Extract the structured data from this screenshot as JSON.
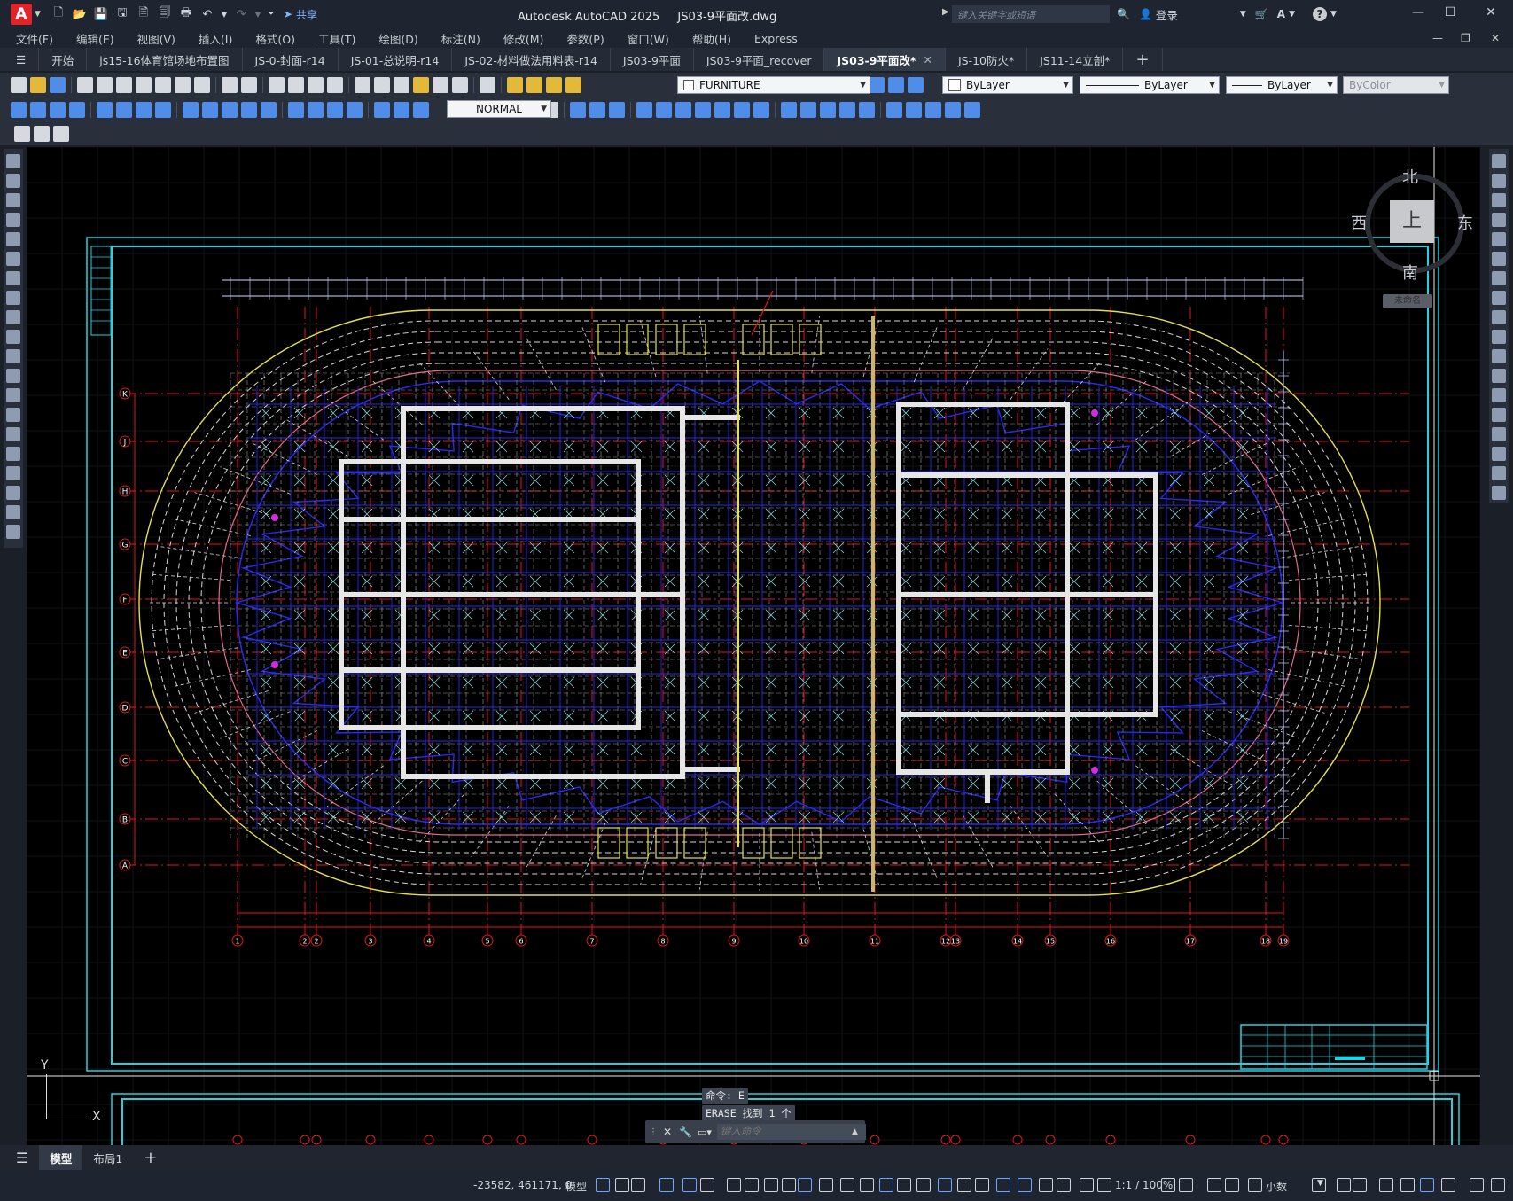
{
  "app": {
    "logo_letter": "A",
    "title": "Autodesk AutoCAD 2025",
    "file": "JS03-9平面改.dwg",
    "share_label": "共享",
    "search_placeholder": "键入关键字或短语",
    "login_label": "登录"
  },
  "menu": [
    "文件(F)",
    "编辑(E)",
    "视图(V)",
    "插入(I)",
    "格式(O)",
    "工具(T)",
    "绘图(D)",
    "标注(N)",
    "修改(M)",
    "参数(P)",
    "窗口(W)",
    "帮助(H)",
    "Express"
  ],
  "doc_tabs": [
    {
      "label": "开始",
      "active": false
    },
    {
      "label": "js15-16体育馆场地布置图",
      "active": false
    },
    {
      "label": "JS-0-封面-r14",
      "active": false
    },
    {
      "label": "JS-01-总说明-r14",
      "active": false
    },
    {
      "label": "JS-02-材料做法用料表-r14",
      "active": false
    },
    {
      "label": "JS03-9平面",
      "active": false
    },
    {
      "label": "JS03-9平面_recover",
      "active": false
    },
    {
      "label": "JS03-9平面改*",
      "active": true
    },
    {
      "label": "JS-10防火*",
      "active": false
    },
    {
      "label": "JS11-14立剖*",
      "active": false
    }
  ],
  "new_tab_label": "+",
  "properties": {
    "layer": "FURNITURE",
    "color": "ByLayer",
    "linetype": "ByLayer",
    "lineweight": "ByLayer",
    "plotstyle": "ByColor",
    "textstyle": "NORMAL"
  },
  "viewcube": {
    "north": "北",
    "south": "南",
    "east": "东",
    "west": "西",
    "top": "上",
    "ucs": "未命名"
  },
  "ucs_axis": {
    "y": "Y",
    "x": "X"
  },
  "grid_rows": [
    "K",
    "J",
    "H",
    "G",
    "F",
    "E",
    "D",
    "C",
    "B",
    "A"
  ],
  "grid_cols": [
    "1",
    "2",
    "2",
    "3",
    "4",
    "5",
    "6",
    "7",
    "8",
    "9",
    "10",
    "11",
    "12",
    "13",
    "14",
    "15",
    "16",
    "17",
    "18",
    "19"
  ],
  "command": {
    "history": [
      "命令: E",
      "ERASE 找到 1 个"
    ],
    "placeholder": "键入命令"
  },
  "layout_tabs": [
    {
      "label": "模型",
      "active": true
    },
    {
      "label": "布局1",
      "active": false
    }
  ],
  "status": {
    "coords": "-23582, 461171, 0",
    "space": "模型",
    "scale": "1:1 / 100%",
    "units": "小数"
  },
  "colors": {
    "accent_cyan": "#1ad6e6",
    "grid_white": "#d8d8d8",
    "structure_blue": "#2a2af0",
    "axis_red": "#e0191e",
    "ellipse_yellow": "#e6e04a",
    "active_tab": "#323a48"
  }
}
